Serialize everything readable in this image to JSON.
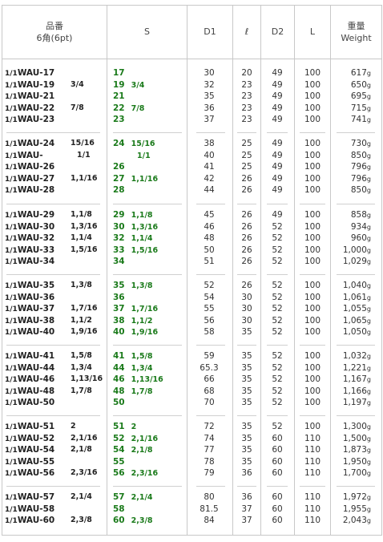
{
  "header": {
    "part_no_line1": "品番",
    "part_no_line2": "6角(6pt)",
    "s": "S",
    "d1": "D1",
    "l_small": "ℓ",
    "d2": "D2",
    "L": "L",
    "weight_line1": "重量",
    "weight_line2": "Weight"
  },
  "prefix": "1/1",
  "weight_unit": "g",
  "groups": [
    [
      {
        "part": "WAU-17",
        "size": "",
        "s": "17",
        "s_in": "",
        "d1": "30",
        "l": "20",
        "d2": "49",
        "L": "100",
        "w": "617"
      },
      {
        "part": "WAU-19",
        "size": "3/4",
        "s": "19",
        "s_in": "3/4",
        "d1": "32",
        "l": "23",
        "d2": "49",
        "L": "100",
        "w": "650"
      },
      {
        "part": "WAU-21",
        "size": "",
        "s": "21",
        "s_in": "",
        "d1": "35",
        "l": "23",
        "d2": "49",
        "L": "100",
        "w": "695"
      },
      {
        "part": "WAU-22",
        "size": "7/8",
        "s": "22",
        "s_in": "7/8",
        "d1": "36",
        "l": "23",
        "d2": "49",
        "L": "100",
        "w": "715"
      },
      {
        "part": "WAU-23",
        "size": "",
        "s": "23",
        "s_in": "",
        "d1": "37",
        "l": "23",
        "d2": "49",
        "L": "100",
        "w": "741"
      }
    ],
    [
      {
        "part": "WAU-24",
        "size": "15/16",
        "s": "24",
        "s_in": "15/16",
        "d1": "38",
        "l": "25",
        "d2": "49",
        "L": "100",
        "w": "730"
      },
      {
        "part": "WAU-",
        "size": "1/1",
        "s": "",
        "s_in": "1/1",
        "d1": "40",
        "l": "25",
        "d2": "49",
        "L": "100",
        "w": "850"
      },
      {
        "part": "WAU-26",
        "size": "",
        "s": "26",
        "s_in": "",
        "d1": "41",
        "l": "25",
        "d2": "49",
        "L": "100",
        "w": "796"
      },
      {
        "part": "WAU-27",
        "size": "1,1/16",
        "s": "27",
        "s_in": "1,1/16",
        "d1": "42",
        "l": "26",
        "d2": "49",
        "L": "100",
        "w": "796"
      },
      {
        "part": "WAU-28",
        "size": "",
        "s": "28",
        "s_in": "",
        "d1": "44",
        "l": "26",
        "d2": "49",
        "L": "100",
        "w": "850"
      }
    ],
    [
      {
        "part": "WAU-29",
        "size": "1,1/8",
        "s": "29",
        "s_in": "1,1/8",
        "d1": "45",
        "l": "26",
        "d2": "49",
        "L": "100",
        "w": "858"
      },
      {
        "part": "WAU-30",
        "size": "1,3/16",
        "s": "30",
        "s_in": "1,3/16",
        "d1": "46",
        "l": "26",
        "d2": "52",
        "L": "100",
        "w": "934"
      },
      {
        "part": "WAU-32",
        "size": "1,1/4",
        "s": "32",
        "s_in": "1,1/4",
        "d1": "48",
        "l": "26",
        "d2": "52",
        "L": "100",
        "w": "960"
      },
      {
        "part": "WAU-33",
        "size": "1,5/16",
        "s": "33",
        "s_in": "1,5/16",
        "d1": "50",
        "l": "26",
        "d2": "52",
        "L": "100",
        "w": "1,000"
      },
      {
        "part": "WAU-34",
        "size": "",
        "s": "34",
        "s_in": "",
        "d1": "51",
        "l": "26",
        "d2": "52",
        "L": "100",
        "w": "1,029"
      }
    ],
    [
      {
        "part": "WAU-35",
        "size": "1,3/8",
        "s": "35",
        "s_in": "1,3/8",
        "d1": "52",
        "l": "26",
        "d2": "52",
        "L": "100",
        "w": "1,040"
      },
      {
        "part": "WAU-36",
        "size": "",
        "s": "36",
        "s_in": "",
        "d1": "54",
        "l": "30",
        "d2": "52",
        "L": "100",
        "w": "1,061"
      },
      {
        "part": "WAU-37",
        "size": "1,7/16",
        "s": "37",
        "s_in": "1,7/16",
        "d1": "55",
        "l": "30",
        "d2": "52",
        "L": "100",
        "w": "1,055"
      },
      {
        "part": "WAU-38",
        "size": "1,1/2",
        "s": "38",
        "s_in": "1,1/2",
        "d1": "56",
        "l": "30",
        "d2": "52",
        "L": "100",
        "w": "1,065"
      },
      {
        "part": "WAU-40",
        "size": "1,9/16",
        "s": "40",
        "s_in": "1,9/16",
        "d1": "58",
        "l": "35",
        "d2": "52",
        "L": "100",
        "w": "1,050"
      }
    ],
    [
      {
        "part": "WAU-41",
        "size": "1,5/8",
        "s": "41",
        "s_in": "1,5/8",
        "d1": "59",
        "l": "35",
        "d2": "52",
        "L": "100",
        "w": "1,032"
      },
      {
        "part": "WAU-44",
        "size": "1,3/4",
        "s": "44",
        "s_in": "1,3/4",
        "d1": "65.3",
        "l": "35",
        "d2": "52",
        "L": "100",
        "w": "1,221"
      },
      {
        "part": "WAU-46",
        "size": "1,13/16",
        "s": "46",
        "s_in": "1,13/16",
        "d1": "66",
        "l": "35",
        "d2": "52",
        "L": "100",
        "w": "1,167"
      },
      {
        "part": "WAU-48",
        "size": "1,7/8",
        "s": "48",
        "s_in": "1,7/8",
        "d1": "68",
        "l": "35",
        "d2": "52",
        "L": "100",
        "w": "1,166"
      },
      {
        "part": "WAU-50",
        "size": "",
        "s": "50",
        "s_in": "",
        "d1": "70",
        "l": "35",
        "d2": "52",
        "L": "100",
        "w": "1,197"
      }
    ],
    [
      {
        "part": "WAU-51",
        "size": "2",
        "s": "51",
        "s_in": "2",
        "d1": "72",
        "l": "35",
        "d2": "52",
        "L": "100",
        "w": "1,300"
      },
      {
        "part": "WAU-52",
        "size": "2,1/16",
        "s": "52",
        "s_in": "2,1/16",
        "d1": "74",
        "l": "35",
        "d2": "60",
        "L": "110",
        "w": "1,500"
      },
      {
        "part": "WAU-54",
        "size": "2,1/8",
        "s": "54",
        "s_in": "2,1/8",
        "d1": "77",
        "l": "35",
        "d2": "60",
        "L": "110",
        "w": "1,873"
      },
      {
        "part": "WAU-55",
        "size": "",
        "s": "55",
        "s_in": "",
        "d1": "78",
        "l": "35",
        "d2": "60",
        "L": "110",
        "w": "1,950"
      },
      {
        "part": "WAU-56",
        "size": "2,3/16",
        "s": "56",
        "s_in": "2,3/16",
        "d1": "79",
        "l": "36",
        "d2": "60",
        "L": "110",
        "w": "1,700"
      }
    ],
    [
      {
        "part": "WAU-57",
        "size": "2,1/4",
        "s": "57",
        "s_in": "2,1/4",
        "d1": "80",
        "l": "36",
        "d2": "60",
        "L": "110",
        "w": "1,972"
      },
      {
        "part": "WAU-58",
        "size": "",
        "s": "58",
        "s_in": "",
        "d1": "81.5",
        "l": "37",
        "d2": "60",
        "L": "110",
        "w": "1,955"
      },
      {
        "part": "WAU-60",
        "size": "2,3/8",
        "s": "60",
        "s_in": "2,3/8",
        "d1": "84",
        "l": "37",
        "d2": "60",
        "L": "110",
        "w": "2,043"
      }
    ]
  ]
}
